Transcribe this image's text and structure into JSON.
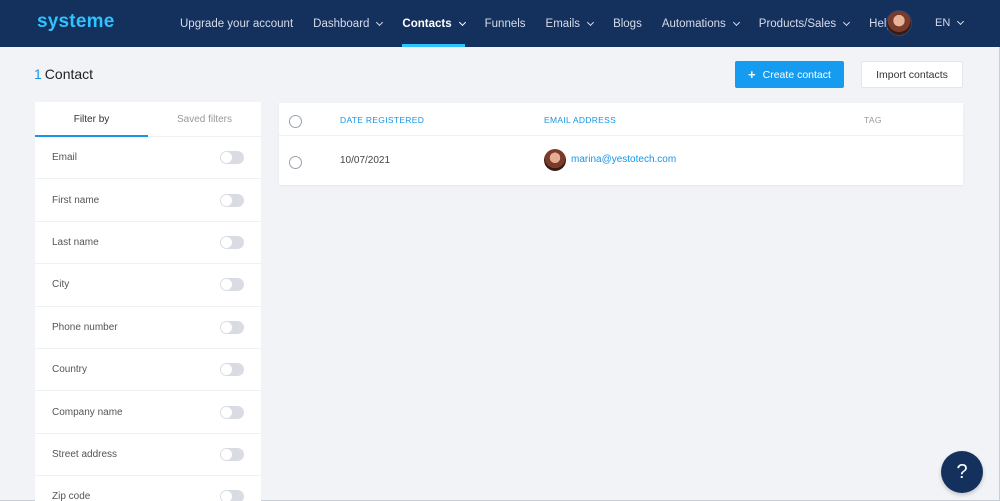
{
  "brand": {
    "logo": "systeme"
  },
  "nav": {
    "items": [
      {
        "label": "Upgrade your account",
        "dropdown": false,
        "active": false
      },
      {
        "label": "Dashboard",
        "dropdown": true,
        "active": false
      },
      {
        "label": "Contacts",
        "dropdown": true,
        "active": true
      },
      {
        "label": "Funnels",
        "dropdown": false,
        "active": false
      },
      {
        "label": "Emails",
        "dropdown": true,
        "active": false
      },
      {
        "label": "Blogs",
        "dropdown": false,
        "active": false
      },
      {
        "label": "Automations",
        "dropdown": true,
        "active": false
      },
      {
        "label": "Products/Sales",
        "dropdown": true,
        "active": false
      },
      {
        "label": "Help",
        "dropdown": false,
        "active": false
      }
    ],
    "language": "EN"
  },
  "page": {
    "count": "1",
    "title": "Contact",
    "create_button": "Create contact",
    "create_icon": "+",
    "import_button": "Import contacts"
  },
  "filters": {
    "tabs": [
      {
        "label": "Filter by",
        "active": true
      },
      {
        "label": "Saved filters",
        "active": false
      }
    ],
    "fields": [
      "Email",
      "First name",
      "Last name",
      "City",
      "Phone number",
      "Country",
      "Company name",
      "Street address",
      "Zip code"
    ]
  },
  "table": {
    "columns": {
      "date": "DATE REGISTERED",
      "email": "EMAIL ADDRESS",
      "tag": "TAG"
    },
    "rows": [
      {
        "date": "10/07/2021",
        "email": "marina@yestotech.com"
      }
    ]
  },
  "help": {
    "icon": "?"
  },
  "colors": {
    "nav_bg": "#14305c",
    "accent": "#1795e6",
    "logo": "#2ec3ff",
    "page_bg": "#f1f3f7"
  }
}
